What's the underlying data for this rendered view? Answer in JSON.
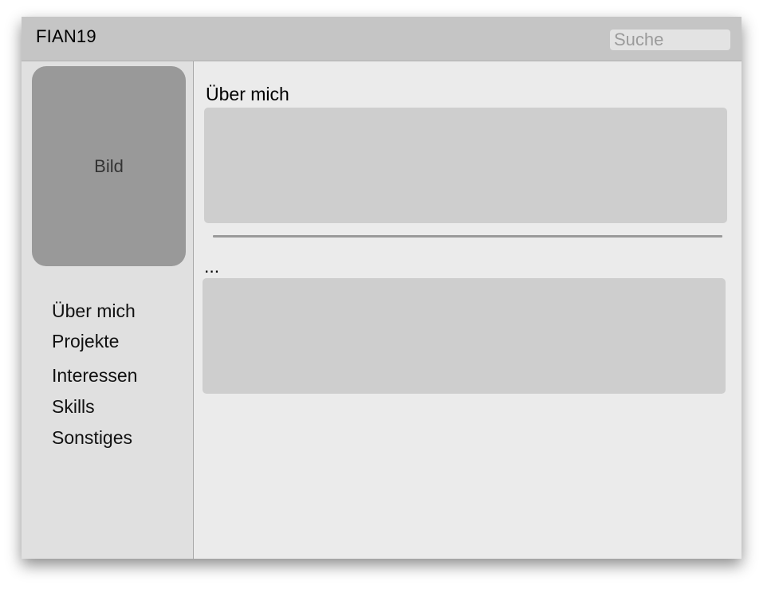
{
  "header": {
    "brand": "FIAN19",
    "search_placeholder": "Suche"
  },
  "sidebar": {
    "photo_label": "Bild",
    "items": [
      {
        "label": "Über mich"
      },
      {
        "label": "Projekte"
      },
      {
        "label": "Interessen"
      },
      {
        "label": "Skills"
      },
      {
        "label": "Sonstiges"
      }
    ]
  },
  "main": {
    "sections": [
      {
        "title": "Über mich"
      },
      {
        "title": "..."
      }
    ]
  },
  "colors": {
    "header_bg": "#c5c5c5",
    "sidebar_bg": "#e0e0e0",
    "main_bg": "#ebebeb",
    "photo_bg": "#999999",
    "content_box_bg": "#cecece",
    "divider": "#9a9a9a"
  }
}
